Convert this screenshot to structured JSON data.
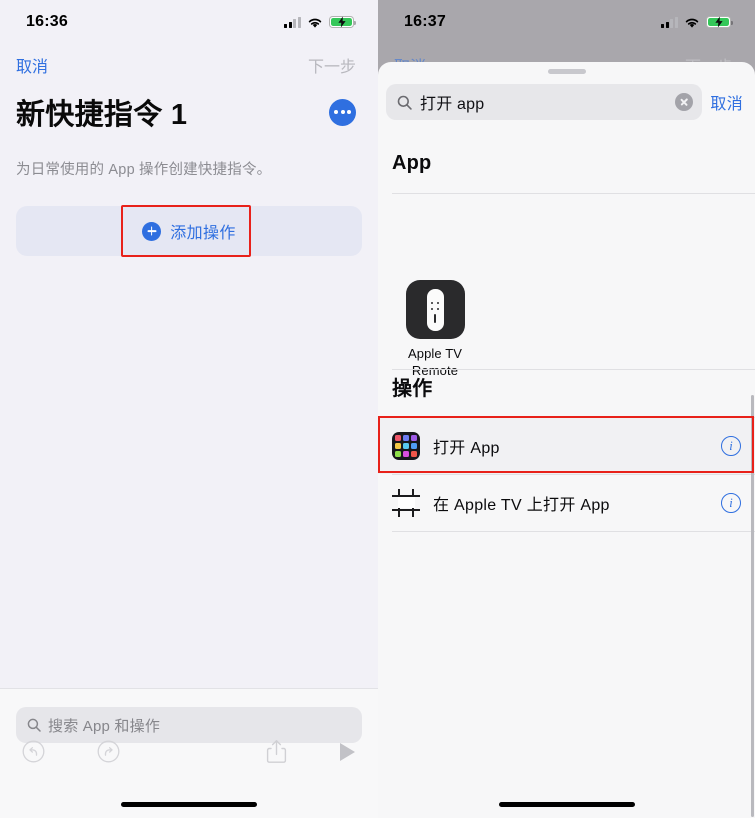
{
  "left": {
    "status": {
      "time": "16:36",
      "cellular_icon": "cellular-bars-icon",
      "wifi_icon": "wifi-icon",
      "battery_icon": "battery-charging-icon"
    },
    "nav": {
      "cancel": "取消",
      "next": "下一步"
    },
    "title": "新快捷指令 1",
    "more_icon": "more-ellipsis-icon",
    "subtitle": "为日常使用的 App 操作创建快捷指令。",
    "add_action": {
      "label": "添加操作",
      "plus_icon": "plus-circle-icon",
      "highlighted": true
    },
    "search": {
      "placeholder": "搜索 App 和操作",
      "icon": "search-icon"
    },
    "toolbar": {
      "undo": "undo-icon",
      "redo": "redo-icon",
      "share": "share-icon",
      "play": "play-icon"
    }
  },
  "right": {
    "status": {
      "time": "16:37",
      "cellular_icon": "cellular-bars-icon",
      "wifi_icon": "wifi-icon",
      "battery_icon": "battery-charging-icon"
    },
    "dim_nav": {
      "cancel": "取消",
      "next": "下一步"
    },
    "sheet": {
      "grabber": "sheet-grabber",
      "search": {
        "value": "打开 app",
        "icon": "search-icon",
        "clear_icon": "clear-circle-icon"
      },
      "cancel": "取消",
      "app_section": {
        "header": "App",
        "items": [
          {
            "name": "Apple TV\nRemote",
            "name_line1": "Apple TV",
            "name_line2": "Remote",
            "icon": "apple-tv-remote-app-icon"
          }
        ]
      },
      "actions_section": {
        "header": "操作",
        "rows": [
          {
            "label": "打开 App",
            "icon": "app-grid-icon",
            "info": "info-icon",
            "highlighted": true
          },
          {
            "label": "在 Apple TV 上打开 App",
            "icon": "apple-tv-frame-icon",
            "info": "info-icon",
            "highlighted": false
          }
        ]
      }
    }
  },
  "colors": {
    "accent_blue": "#2f6fe0",
    "highlight_red": "#e8211a",
    "battery_green": "#34c759",
    "left_bg": "#f2f1f7",
    "sheet_bg": "#f7f7f8",
    "dim_bg": "#a9a7ac"
  }
}
